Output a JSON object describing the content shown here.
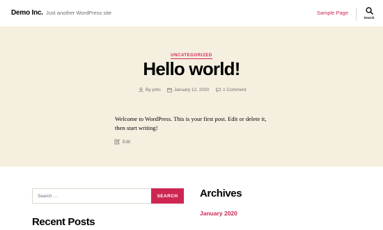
{
  "header": {
    "site_title": "Demo Inc.",
    "site_description": "Just another WordPress site",
    "nav": [
      {
        "label": "Sample Page"
      }
    ],
    "search_label": "Search"
  },
  "post": {
    "category": "UNCATEGORIZED",
    "title": "Hello world!",
    "meta": {
      "author": "By john",
      "date": "January 12, 2020",
      "comments": "1 Comment"
    },
    "content": "Welcome to WordPress. This is your first post. Edit or delete it, then start writing!",
    "edit_label": "Edit"
  },
  "widgets": {
    "search": {
      "placeholder": "Search …",
      "button_label": "SEARCH"
    },
    "recent_posts_title": "Recent Posts",
    "archives_title": "Archives",
    "archives": [
      {
        "label": "January 2020"
      }
    ]
  },
  "colors": {
    "accent": "#cd2653",
    "hero_background": "#f5efe0",
    "meta_text": "#6d6d6d",
    "border": "#dcd7ca"
  },
  "icons": [
    "search-icon",
    "user-icon",
    "calendar-icon",
    "comment-icon",
    "edit-icon"
  ]
}
